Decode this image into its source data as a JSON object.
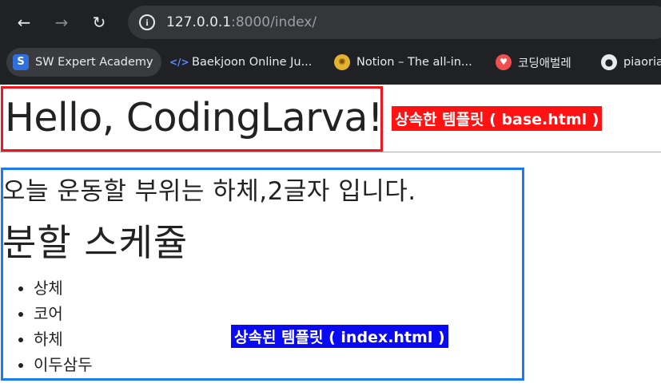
{
  "browser": {
    "url_host": "127.0.0.1",
    "url_rest": ":8000/index/",
    "bookmarks": [
      {
        "label": "SW Expert Academy",
        "icon": "swea-icon",
        "glyph": "S"
      },
      {
        "label": "Baekjoon Online Ju...",
        "icon": "code-brackets-icon",
        "glyph": "</>"
      },
      {
        "label": "Notion – The all-in...",
        "icon": "notion-sun-icon",
        "glyph": "✺"
      },
      {
        "label": "코딩애벌레",
        "icon": "coding-larva-icon",
        "glyph": "♥"
      },
      {
        "label": "piaoria",
        "icon": "github-icon",
        "glyph": "●"
      }
    ]
  },
  "page": {
    "heading": "Hello, CodingLarva!",
    "base_label": "상속한 템플릿 ( base.html )",
    "message": "오늘 운동할 부위는 하체,2글자 입니다.",
    "schedule_title": "분할 스케쥴",
    "schedule_items": [
      "상체",
      "코어",
      "하체",
      "이두삼두"
    ],
    "index_label": "상속된 템플릿 ( index.html )"
  },
  "colors": {
    "base_box": "#f5141b",
    "index_box": "#1a7cf0",
    "base_label_bg": "#ff1212",
    "index_label_bg": "#0a0af2"
  }
}
